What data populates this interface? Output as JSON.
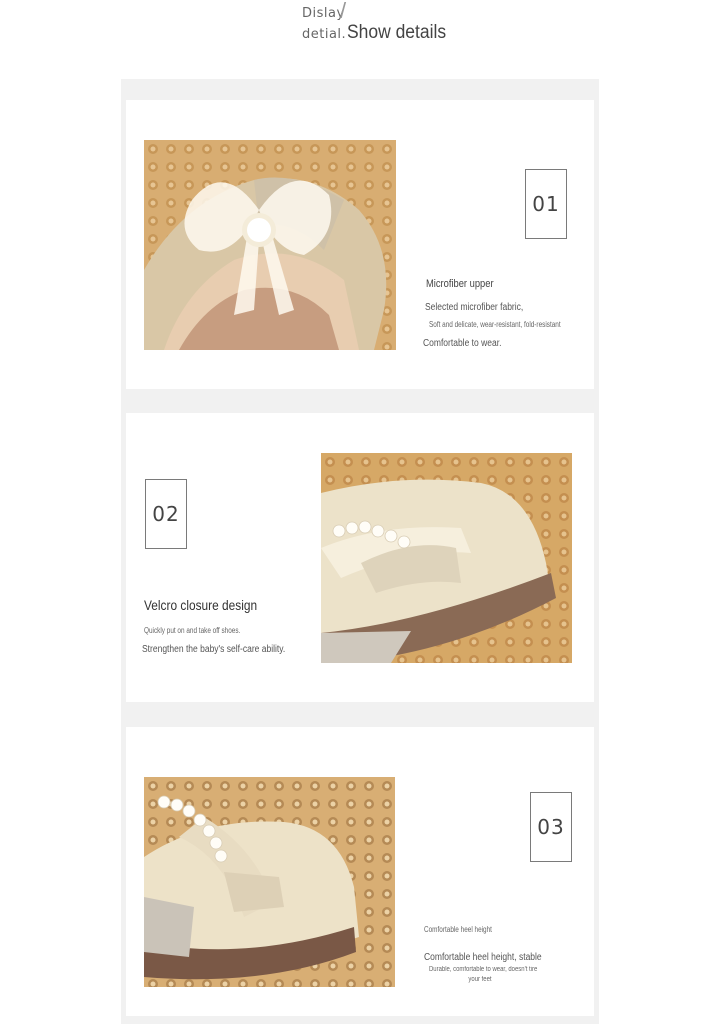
{
  "header": {
    "line1": "Dislay",
    "slash": "/",
    "line2": "detial.",
    "title": "Show details"
  },
  "sections": [
    {
      "number": "01",
      "title": "Microfiber upper",
      "line1": "Selected microfiber fabric,",
      "line2": "Soft and delicate, wear-resistant, fold-resistant",
      "line3": "Comfortable to wear."
    },
    {
      "number": "02",
      "title": "Velcro closure design",
      "line1": "Quickly put on and take off shoes.",
      "line2": "Strengthen the baby's self-care ability."
    },
    {
      "number": "03",
      "title": "Comfortable heel height",
      "line1": "Comfortable heel height, stable",
      "line2": "Durable, comfortable to wear, doesn't tire",
      "line3": "your feet"
    }
  ],
  "colors": {
    "frame": "#f1f1f1",
    "panel": "#ffffff",
    "mat": "#d9b27a",
    "shoe": "#efe4cc"
  }
}
